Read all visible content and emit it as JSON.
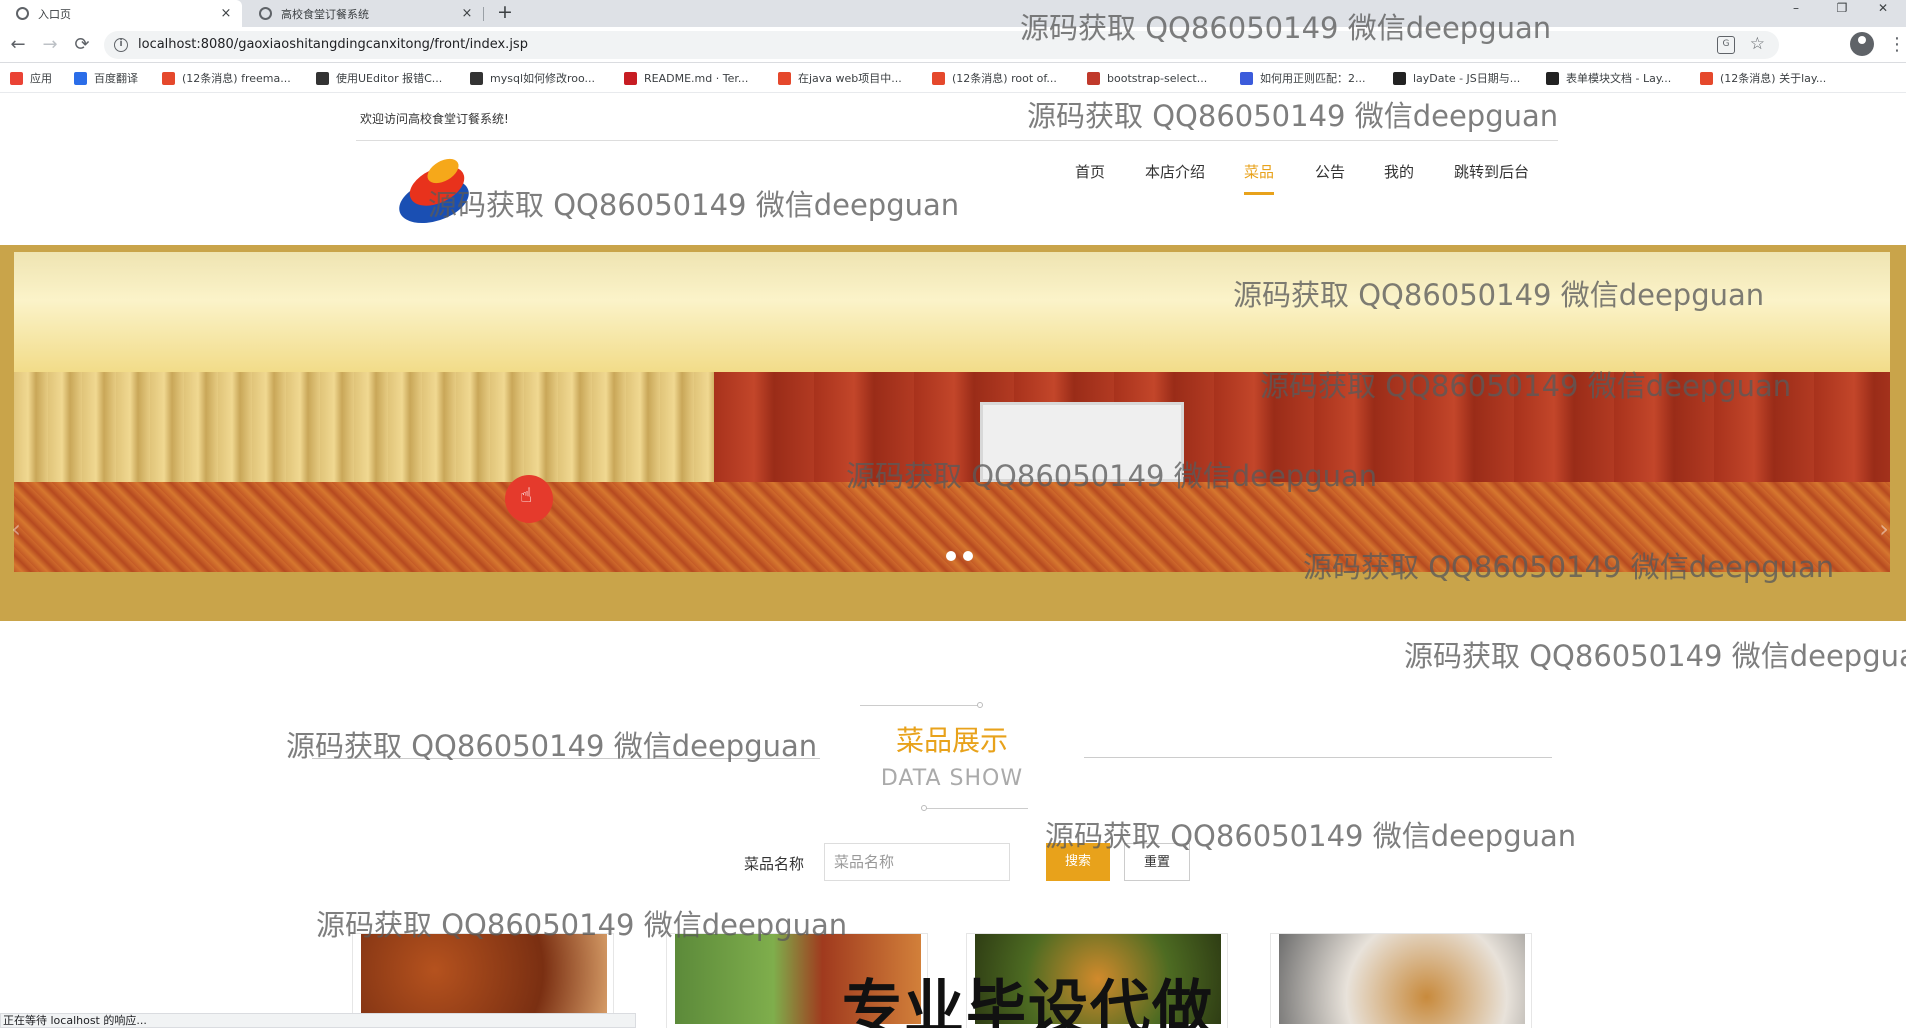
{
  "browser": {
    "tabs": [
      {
        "title": "入口页",
        "close": "×"
      },
      {
        "title": "高校食堂订餐系统",
        "close": "×"
      }
    ],
    "new_tab": "+",
    "window_controls": {
      "minimize": "–",
      "maximize": "❐",
      "close": "✕"
    },
    "url": "localhost:8080/gaoxiaoshitangdingcanxitong/front/index.jsp",
    "bookmarks": [
      {
        "label": "应用",
        "icon": "apps-grid-icon",
        "color": "#ea4335"
      },
      {
        "label": "百度翻译",
        "icon": "baidu-translate-icon",
        "color": "#2b6de8"
      },
      {
        "label": "(12条消息) freema...",
        "icon": "csdn-icon",
        "color": "#e5482c"
      },
      {
        "label": "使用UEditor 报错C...",
        "icon": "feather-icon",
        "color": "#333333"
      },
      {
        "label": "mysql如何修改roo...",
        "icon": "feather-icon",
        "color": "#333333"
      },
      {
        "label": "README.md · Ter...",
        "icon": "gitee-icon",
        "color": "#c71d23"
      },
      {
        "label": "在java web项目中...",
        "icon": "csdn-icon",
        "color": "#e5482c"
      },
      {
        "label": "(12条消息) root of...",
        "icon": "csdn-icon",
        "color": "#e5482c"
      },
      {
        "label": "bootstrap-select...",
        "icon": "docs-icon",
        "color": "#c0392b"
      },
      {
        "label": "如何用正则匹配：2...",
        "icon": "paw-icon",
        "color": "#3b5bdb"
      },
      {
        "label": "layDate - JS日期与...",
        "icon": "layui-icon",
        "color": "#222222"
      },
      {
        "label": "表单模块文档 - Lay...",
        "icon": "layui-icon",
        "color": "#222222"
      },
      {
        "label": "(12条消息) 关于lay...",
        "icon": "csdn-icon",
        "color": "#e5482c"
      }
    ],
    "status_text": "正在等待 localhost 的响应..."
  },
  "site": {
    "welcome": "欢迎访问高校食堂订餐系统!",
    "nav": [
      {
        "label": "首页",
        "active": false
      },
      {
        "label": "本店介绍",
        "active": false
      },
      {
        "label": "菜品",
        "active": true
      },
      {
        "label": "公告",
        "active": false
      },
      {
        "label": "我的",
        "active": false
      },
      {
        "label": "跳转到后台",
        "active": false
      }
    ],
    "accent_color": "#e8a21b",
    "carousel": {
      "slide_count": 2,
      "prev": "‹",
      "next": "›"
    },
    "section": {
      "title": "菜品展示",
      "subtitle": "DATA SHOW"
    },
    "search": {
      "label": "菜品名称",
      "placeholder": "菜品名称",
      "value": "",
      "search_button": "搜索",
      "reset_button": "重置"
    },
    "dish_count_visible": 4
  },
  "overlays": {
    "watermark": "源码获取 QQ86050149 微信deepguan",
    "ad_text": "专业毕设代做"
  }
}
